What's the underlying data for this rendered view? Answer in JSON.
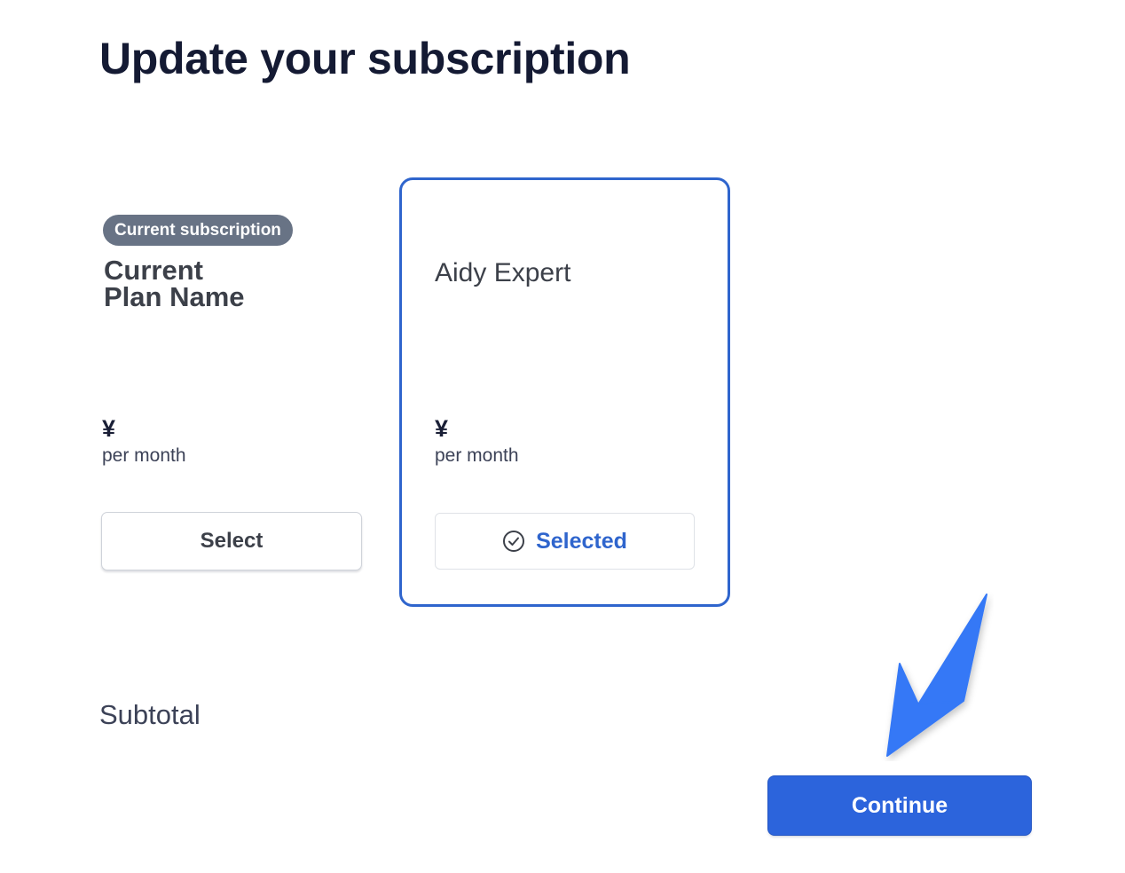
{
  "page": {
    "title": "Update your subscription"
  },
  "current_plan": {
    "badge": "Current subscription",
    "name_line1": "Current",
    "name_line2": "Plan Name",
    "currency": "¥",
    "period": "per month",
    "button_label": "Select"
  },
  "selected_plan": {
    "name": "Aidy Expert",
    "currency": "¥",
    "period": "per month",
    "button_label": "Selected",
    "icon": "check-circle-icon"
  },
  "summary": {
    "subtotal_label": "Subtotal"
  },
  "actions": {
    "continue_label": "Continue"
  },
  "colors": {
    "accent": "#2c64dc",
    "selected_border": "#2f65cd",
    "badge_bg": "#687385",
    "title": "#141a33",
    "arrow": "#3478f6"
  }
}
